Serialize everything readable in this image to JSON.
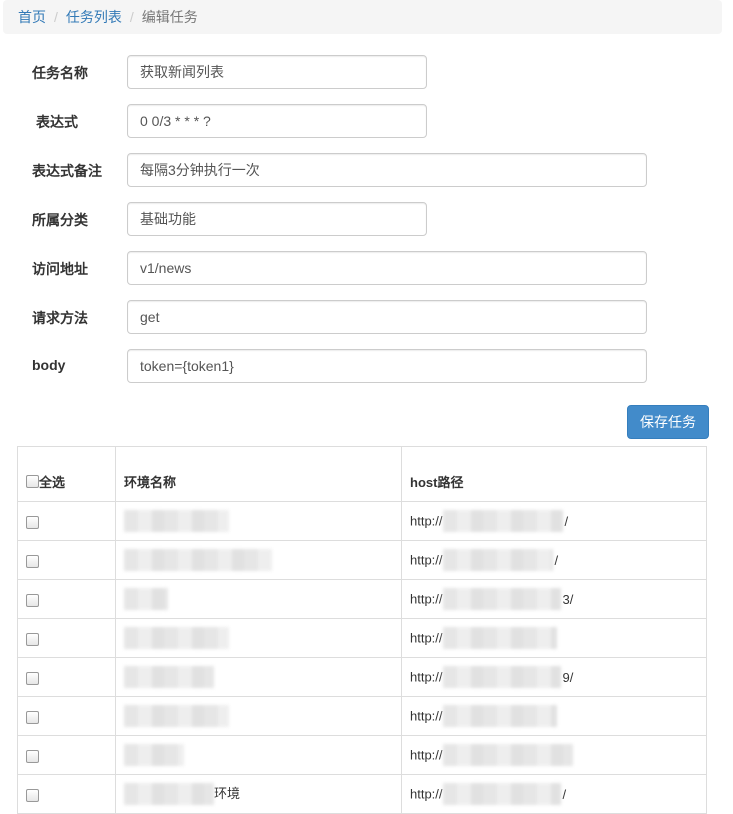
{
  "breadcrumb": {
    "home": "首页",
    "task_list": "任务列表",
    "current": "编辑任务",
    "separator": "/"
  },
  "form": {
    "task_name": {
      "label": "任务名称",
      "value": "获取新闻列表"
    },
    "expression": {
      "label": "表达式",
      "value": "0 0/3 * * * ?"
    },
    "expression_note": {
      "label": "表达式备注",
      "value": "每隔3分钟执行一次"
    },
    "category": {
      "label": "所属分类",
      "value": "基础功能"
    },
    "url": {
      "label": "访问地址",
      "value": "v1/news"
    },
    "method": {
      "label": "请求方法",
      "value": "get"
    },
    "body": {
      "label": "body",
      "value": "token={token1}"
    }
  },
  "save_button": {
    "label": "保存任务"
  },
  "env_table": {
    "select_all_label": "全选",
    "col_env_name": "环境名称",
    "col_host": "host路径",
    "rows": [
      {
        "name_visible": "",
        "host_prefix": "http://",
        "host_suffix": "/"
      },
      {
        "name_visible": "",
        "host_prefix": "http://",
        "host_suffix": "/"
      },
      {
        "name_visible": "",
        "host_prefix": "http://",
        "host_suffix": "3/"
      },
      {
        "name_visible": "",
        "host_prefix": "http://",
        "host_suffix": ""
      },
      {
        "name_visible": "",
        "host_prefix": "http://",
        "host_suffix": "9/"
      },
      {
        "name_visible": "",
        "host_prefix": "http://",
        "host_suffix": ""
      },
      {
        "name_visible": "",
        "host_prefix": "http://",
        "host_suffix": ""
      },
      {
        "name_visible": "环境",
        "host_prefix": "http://",
        "host_suffix": "/"
      }
    ]
  },
  "colors": {
    "link": "#337ab7",
    "primary_button": "#428bca",
    "breadcrumb_bg": "#f5f5f5"
  }
}
